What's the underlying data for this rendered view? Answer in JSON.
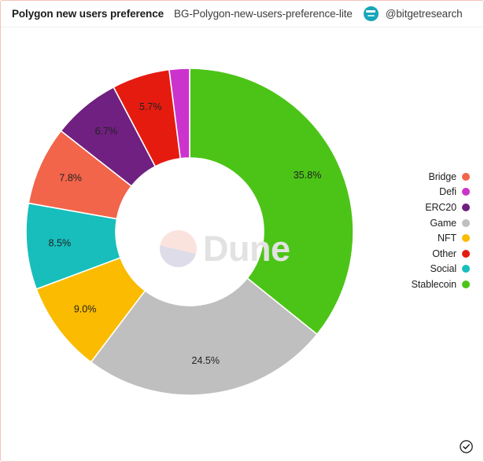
{
  "header": {
    "title": "Polygon new users preference",
    "subtitle": "BG-Polygon-new-users-preference-lite",
    "author_handle": "@bitgetresearch",
    "avatar_name": "bitget-logo-avatar"
  },
  "watermark": {
    "text": "Dune"
  },
  "footer": {
    "verified_icon": "check-circle-icon"
  },
  "legend": {
    "items": [
      {
        "label": "Bridge",
        "color": "#F2654A"
      },
      {
        "label": "Defi",
        "color": "#CC33CC"
      },
      {
        "label": "ERC20",
        "color": "#6F2080"
      },
      {
        "label": "Game",
        "color": "#BFBFBF"
      },
      {
        "label": "NFT",
        "color": "#FABB00"
      },
      {
        "label": "Other",
        "color": "#E51B10"
      },
      {
        "label": "Social",
        "color": "#17BEBB"
      },
      {
        "label": "Stablecoin",
        "color": "#4CC417"
      }
    ]
  },
  "chart_data": {
    "type": "pie",
    "title": "Polygon new users preference",
    "subtitle": "BG-Polygon-new-users-preference-lite",
    "donut": true,
    "inner_radius_ratio": 0.45,
    "start_angle_deg": -90,
    "direction": "clockwise",
    "legend_position": "right",
    "value_unit": "%",
    "categories": [
      "Stablecoin",
      "Game",
      "NFT",
      "Social",
      "Bridge",
      "ERC20",
      "Other",
      "Defi"
    ],
    "values": [
      35.8,
      24.5,
      9.0,
      8.5,
      7.8,
      6.7,
      5.7,
      2.0
    ],
    "labels": [
      "35.8%",
      "24.5%",
      "9.0%",
      "8.5%",
      "7.8%",
      "6.7%",
      "5.7%",
      ""
    ],
    "colors": [
      "#4CC417",
      "#BFBFBF",
      "#FABB00",
      "#17BEBB",
      "#F2654A",
      "#6F2080",
      "#E51B10",
      "#CC33CC"
    ],
    "slices": [
      {
        "name": "Stablecoin",
        "value": 35.8,
        "label": "35.8%",
        "color": "#4CC417",
        "show_label": true
      },
      {
        "name": "Game",
        "value": 24.5,
        "label": "24.5%",
        "color": "#BFBFBF",
        "show_label": true
      },
      {
        "name": "NFT",
        "value": 9.0,
        "label": "9.0%",
        "color": "#FABB00",
        "show_label": true
      },
      {
        "name": "Social",
        "value": 8.5,
        "label": "8.5%",
        "color": "#17BEBB",
        "show_label": true
      },
      {
        "name": "Bridge",
        "value": 7.8,
        "label": "7.8%",
        "color": "#F2654A",
        "show_label": true
      },
      {
        "name": "ERC20",
        "value": 6.7,
        "label": "6.7%",
        "color": "#6F2080",
        "show_label": true
      },
      {
        "name": "Other",
        "value": 5.7,
        "label": "5.7%",
        "color": "#E51B10",
        "show_label": true
      },
      {
        "name": "Defi",
        "value": 2.0,
        "label": "2.0%",
        "color": "#CC33CC",
        "show_label": false
      }
    ],
    "xlabel": "",
    "ylabel": ""
  }
}
